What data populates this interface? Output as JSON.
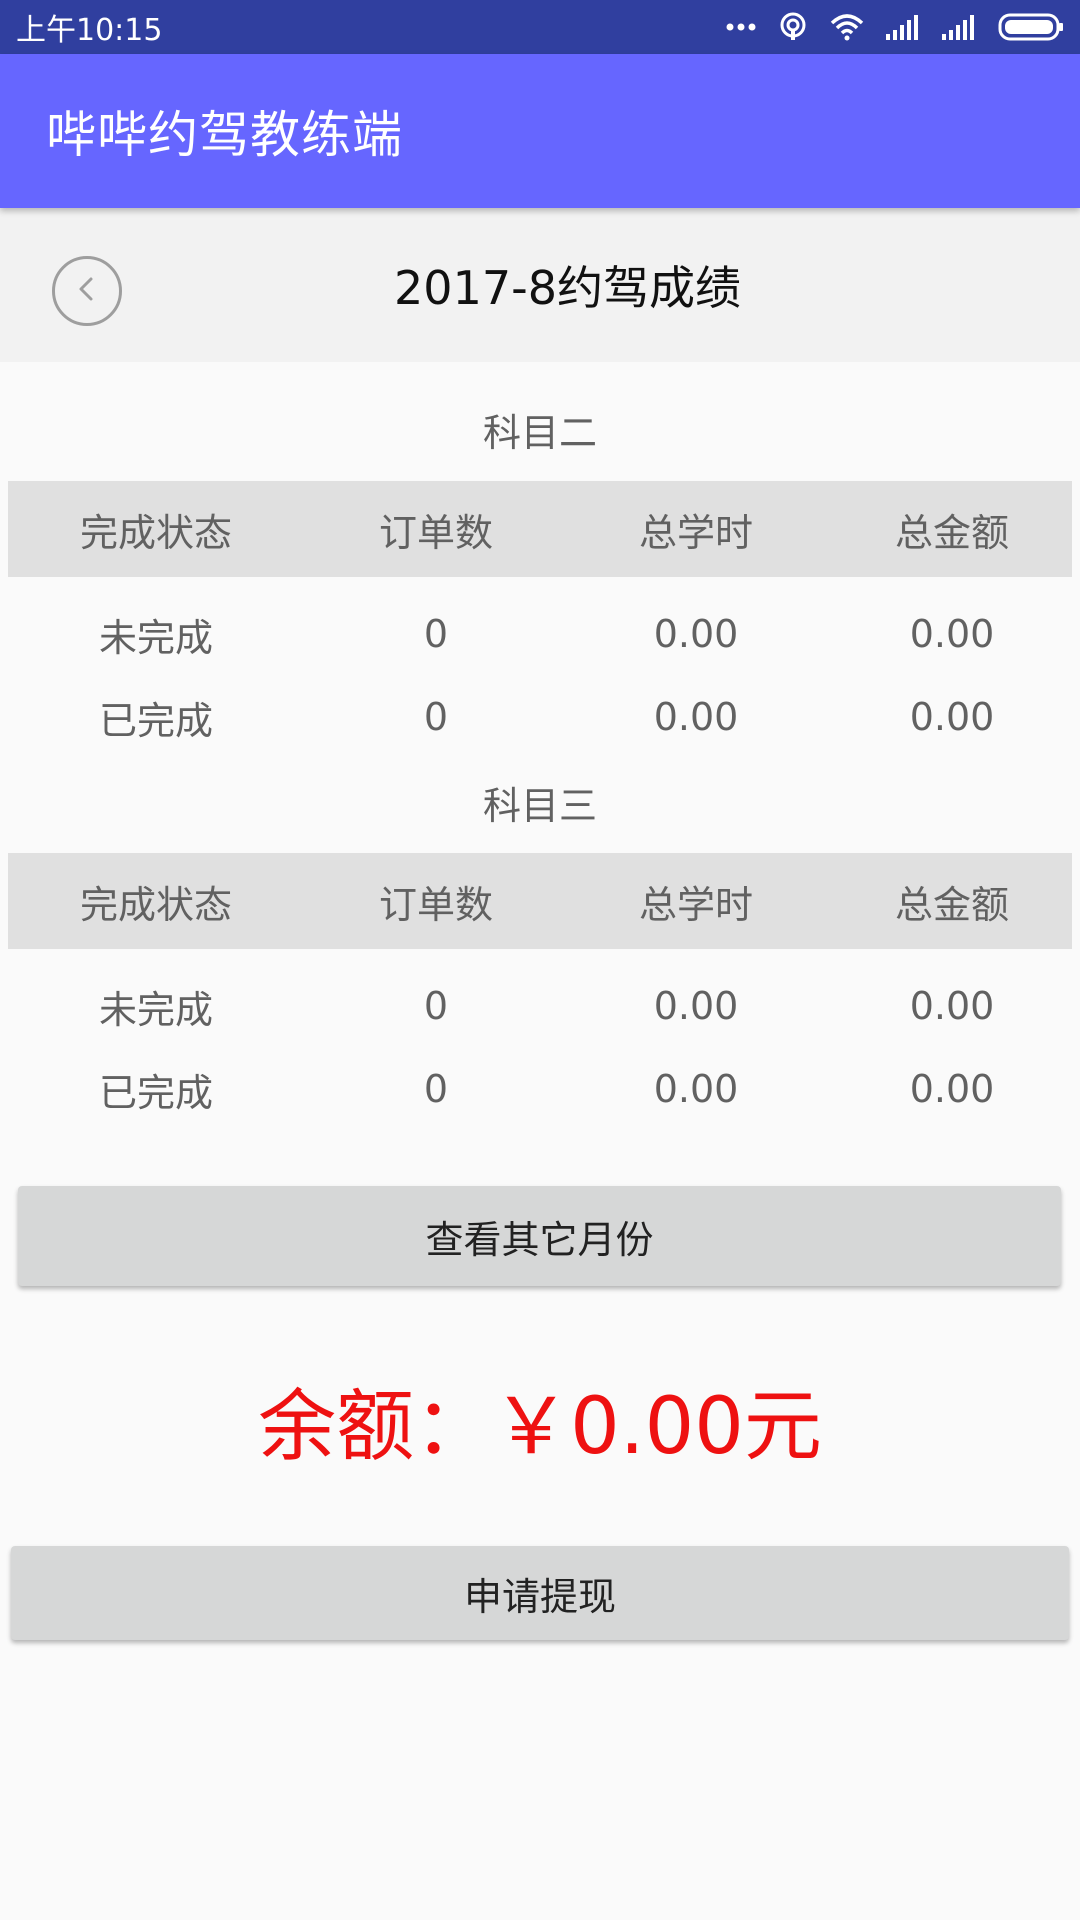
{
  "status_bar": {
    "time": "上午10:15",
    "icons": [
      "more-dots-icon",
      "hotspot-icon",
      "wifi-icon",
      "signal-icon",
      "signal-icon",
      "battery-icon"
    ]
  },
  "app_bar": {
    "title": "哔哔约驾教练端"
  },
  "header": {
    "back_icon": "back-circle-icon",
    "title": "2017-8约驾成绩"
  },
  "sections": [
    {
      "title": "科目二",
      "columns": [
        "完成状态",
        "订单数",
        "总学时",
        "总金额"
      ],
      "rows": [
        [
          "未完成",
          "0",
          "0.00",
          "0.00"
        ],
        [
          "已完成",
          "0",
          "0.00",
          "0.00"
        ]
      ]
    },
    {
      "title": "科目三",
      "columns": [
        "完成状态",
        "订单数",
        "总学时",
        "总金额"
      ],
      "rows": [
        [
          "未完成",
          "0",
          "0.00",
          "0.00"
        ],
        [
          "已完成",
          "0",
          "0.00",
          "0.00"
        ]
      ]
    }
  ],
  "other_months_button": "查看其它月份",
  "balance": "余额：￥0.00元",
  "withdraw_button": "申请提现",
  "colors": {
    "status_bar": "#303f9f",
    "app_bar": "#6666ff",
    "balance": "#ee1111",
    "table_header": "#e0e0e0",
    "button": "#d6d7d7"
  }
}
